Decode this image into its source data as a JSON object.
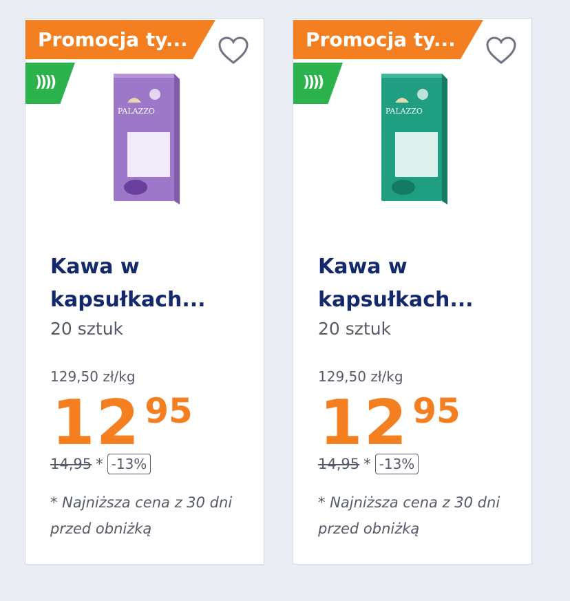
{
  "products": [
    {
      "promo_label": "Promocja ty...",
      "speed_badge": "))))",
      "brand_text": "PALAZZO",
      "name": "Kawa w kapsułkach...",
      "unit": "20 sztuk",
      "price_per_kg": "129,50 zł/kg",
      "price_int": "12",
      "price_dec": "95",
      "old_price": "14,95",
      "old_price_mark": "*",
      "discount": "-13%",
      "lowest_price_note": "* Najniższa cena z 30 dni przed obniżką",
      "box_color": "#9d78c9",
      "capsule_color": "#6a3f9e"
    },
    {
      "promo_label": "Promocja ty...",
      "speed_badge": "))))",
      "brand_text": "PALAZZO",
      "name": "Kawa w kapsułkach...",
      "unit": "20 sztuk",
      "price_per_kg": "129,50 zł/kg",
      "price_int": "12",
      "price_dec": "95",
      "old_price": "14,95",
      "old_price_mark": "*",
      "discount": "-13%",
      "lowest_price_note": "* Najniższa cena z 30 dni przed obniżką",
      "box_color": "#1f9e82",
      "capsule_color": "#157a63"
    }
  ],
  "colors": {
    "promo": "#f47f20",
    "speed": "#2bb24c",
    "title": "#13296b",
    "price": "#f47f20"
  },
  "icons": {
    "favorite": "heart-outline-icon",
    "speed": "fast-delivery-icon"
  }
}
